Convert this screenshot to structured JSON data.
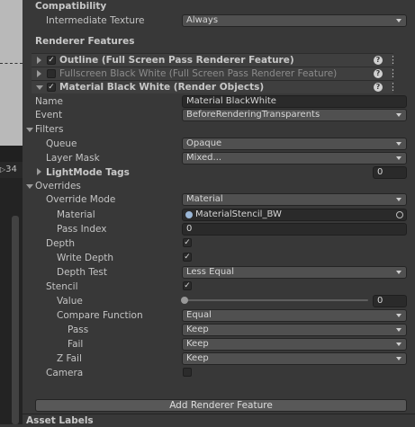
{
  "left": {
    "number_label": "34",
    "fold_glyph": "▷"
  },
  "compatibility": {
    "section_title": "Compatibility",
    "intermediate_texture_label": "Intermediate Texture",
    "intermediate_texture_value": "Always"
  },
  "renderer_features": {
    "section_title": "Renderer Features",
    "features": [
      {
        "name": "Outline (Full Screen Pass Renderer Feature)",
        "enabled": true
      },
      {
        "name": "Fullscreen Black White (Full Screen Pass Renderer Feature)",
        "enabled": false
      },
      {
        "name": "Material Black White (Render Objects)",
        "enabled": true
      }
    ],
    "help_glyph": "?",
    "menu_glyph": "⋮",
    "check_glyph": "✓"
  },
  "properties": {
    "name_label": "Name",
    "name_value": "Material BlackWhite",
    "event_label": "Event",
    "event_value": "BeforeRenderingTransparents",
    "filters_label": "Filters",
    "queue_label": "Queue",
    "queue_value": "Opaque",
    "layer_mask_label": "Layer Mask",
    "layer_mask_value": "Mixed...",
    "lightmode_tags_label": "LightMode Tags",
    "lightmode_tags_count": "0",
    "overrides_label": "Overrides",
    "override_mode_label": "Override Mode",
    "override_mode_value": "Material",
    "material_label": "Material",
    "material_value": "MaterialStencil_BW",
    "pass_index_label": "Pass Index",
    "pass_index_value": "0",
    "depth_label": "Depth",
    "depth_enabled": true,
    "write_depth_label": "Write Depth",
    "write_depth_enabled": true,
    "depth_test_label": "Depth Test",
    "depth_test_value": "Less Equal",
    "stencil_label": "Stencil",
    "stencil_enabled": true,
    "value_label": "Value",
    "value_slider_value": "0",
    "value_slider_fraction": 0,
    "compare_function_label": "Compare Function",
    "compare_function_value": "Equal",
    "pass_label": "Pass",
    "pass_value": "Keep",
    "fail_label": "Fail",
    "fail_value": "Keep",
    "zfail_label": "Z Fail",
    "zfail_value": "Keep",
    "camera_label": "Camera",
    "camera_enabled": false
  },
  "add_renderer_feature_label": "Add Renderer Feature",
  "asset_labels_title": "Asset Labels",
  "colors": {
    "background": "#383838",
    "field": "#515151",
    "input": "#2a2a2a",
    "text": "#c4c4c4"
  }
}
